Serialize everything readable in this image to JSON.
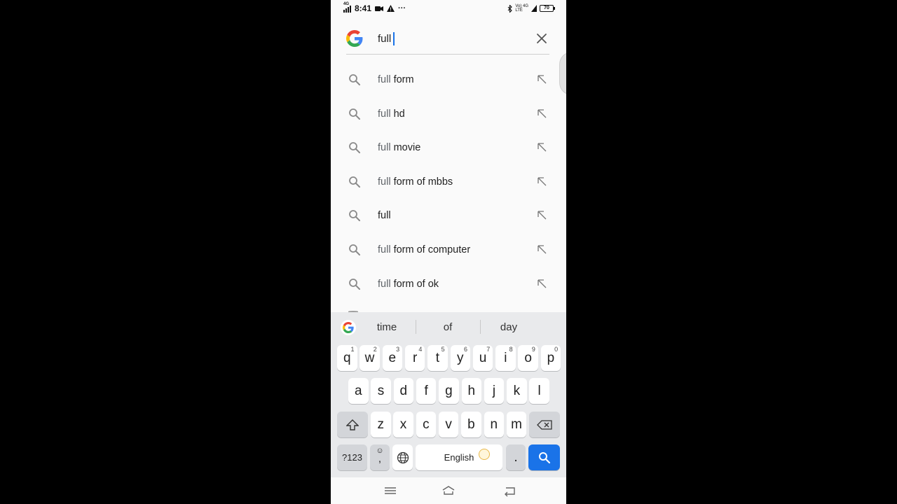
{
  "status_bar": {
    "time": "8:41",
    "network": "4G",
    "more": "···",
    "volte": "Vo) 4G",
    "lte": "LTE",
    "battery": "70"
  },
  "search": {
    "query": "full"
  },
  "suggestions": [
    {
      "prefix": "full",
      "rest": " form"
    },
    {
      "prefix": "full",
      "rest": " hd"
    },
    {
      "prefix": "full",
      "rest": " movie"
    },
    {
      "prefix": "full",
      "rest": " form of mbbs"
    },
    {
      "prefix": "",
      "rest": "full"
    },
    {
      "prefix": "full",
      "rest": " form of computer"
    },
    {
      "prefix": "full",
      "rest": " form of ok"
    }
  ],
  "keyboard": {
    "word_suggestions": [
      "time",
      "of",
      "day"
    ],
    "row1": [
      {
        "k": "q",
        "n": "1"
      },
      {
        "k": "w",
        "n": "2"
      },
      {
        "k": "e",
        "n": "3"
      },
      {
        "k": "r",
        "n": "4"
      },
      {
        "k": "t",
        "n": "5"
      },
      {
        "k": "y",
        "n": "6"
      },
      {
        "k": "u",
        "n": "7"
      },
      {
        "k": "i",
        "n": "8"
      },
      {
        "k": "o",
        "n": "9"
      },
      {
        "k": "p",
        "n": "0"
      }
    ],
    "row2": [
      "a",
      "s",
      "d",
      "f",
      "g",
      "h",
      "j",
      "k",
      "l"
    ],
    "row3": [
      "z",
      "x",
      "c",
      "v",
      "b",
      "n",
      "m"
    ],
    "symbols_label": "?123",
    "comma_label": ",",
    "emoji_label": "☺",
    "space_label": "English",
    "period_label": "."
  },
  "colors": {
    "accent": "#1a73e8",
    "keyboard_bg": "#e9eaec",
    "page_bg": "#fafafa"
  }
}
